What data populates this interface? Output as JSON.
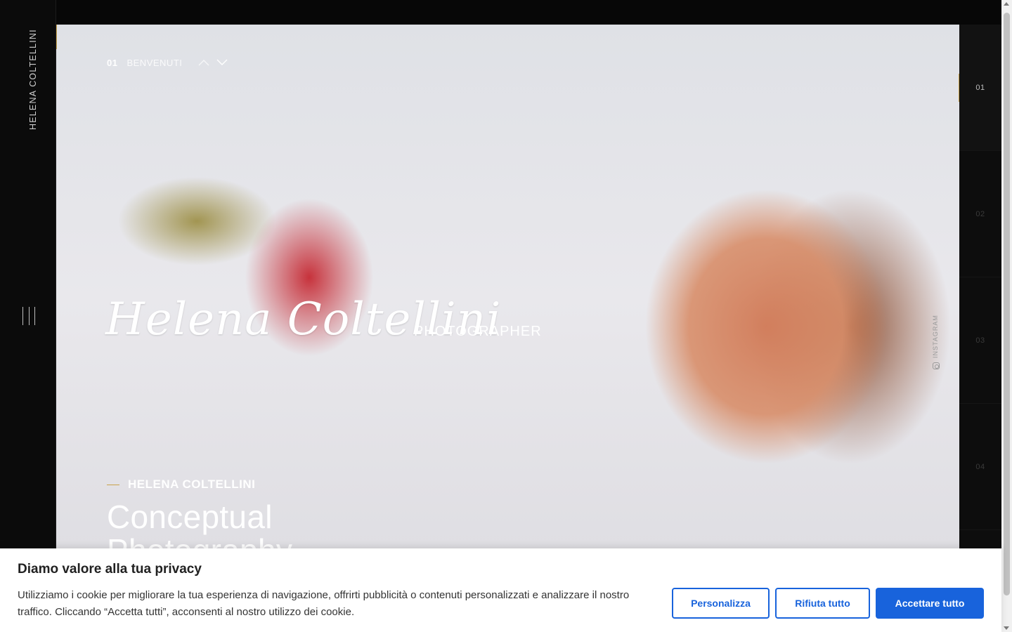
{
  "sidebar": {
    "brand_vertical": "HELENA COLTELLINI",
    "menu_icon": "menu-bars-icon"
  },
  "hero": {
    "slide_number": "01",
    "slide_label": "BENVENUTI",
    "script_title": "Helena Coltellini",
    "script_subtitle": "PHOTOGRAPHER",
    "eyebrow": "HELENA COLTELLINI",
    "headline_line1": "Conceptual",
    "headline_line2": "Photography",
    "instagram_label": "INSTAGRAM",
    "prev_icon": "chevron-up-icon",
    "next_icon": "chevron-down-icon"
  },
  "right_nav": {
    "items": [
      "01",
      "02",
      "03",
      "04"
    ],
    "active": "01"
  },
  "cookie_banner": {
    "title": "Diamo valore alla tua privacy",
    "text": "Utilizziamo i cookie per migliorare la tua esperienza di navigazione, offrirti pubblicità o contenuti personalizzati e analizzare il nostro traffico. Cliccando “Accetta tutti”, acconsenti al nostro utilizzo dei cookie.",
    "customize_label": "Personalizza",
    "reject_label": "Rifiuta tutto",
    "accept_label": "Accettare tutto"
  },
  "colors": {
    "accent_gold": "#c9a24a",
    "button_blue": "#1863dc",
    "background_dark": "#0b0b0b"
  }
}
